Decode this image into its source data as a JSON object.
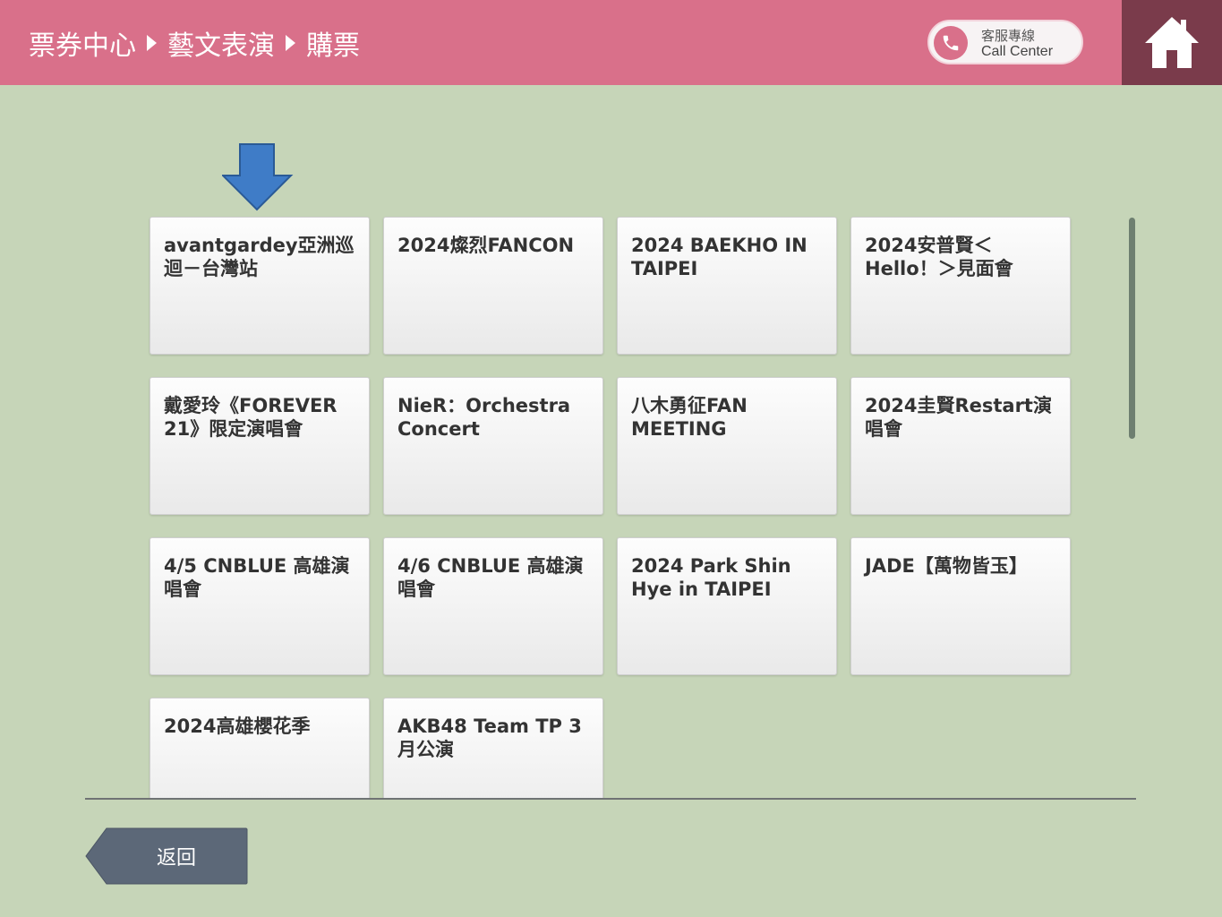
{
  "header": {
    "breadcrumb": [
      "票券中心",
      "藝文表演",
      "購票"
    ],
    "call_center": {
      "label_zh": "客服專線",
      "label_en": "Call Center"
    },
    "home_icon": "home-icon",
    "background_color": "#d9708a",
    "home_background_color": "#7a3b4b"
  },
  "events": [
    {
      "title": "avantgardey亞洲巡迴－台灣站"
    },
    {
      "title": "2024燦烈FANCON"
    },
    {
      "title": "2024 BAEKHO IN TAIPEI"
    },
    {
      "title": "2024安普賢＜Hello！＞見面會"
    },
    {
      "title": "戴愛玲《FOREVER 21》限定演唱會"
    },
    {
      "title": "NieR：Orchestra Concert"
    },
    {
      "title": "八木勇征FAN MEETING"
    },
    {
      "title": "2024圭賢Restart演唱會"
    },
    {
      "title": "4/5 CNBLUE 高雄演唱會"
    },
    {
      "title": "4/6 CNBLUE 高雄演唱會"
    },
    {
      "title": "2024 Park Shin Hye in TAIPEI"
    },
    {
      "title": "JADE【萬物皆玉】"
    },
    {
      "title": "2024高雄櫻花季"
    },
    {
      "title": "AKB48 Team TP 3月公演"
    }
  ],
  "footer": {
    "back_label": "返回"
  },
  "colors": {
    "page_background": "#c6d5b8",
    "pointer_arrow": "#3f7cc7",
    "back_button": "#5c6878"
  }
}
